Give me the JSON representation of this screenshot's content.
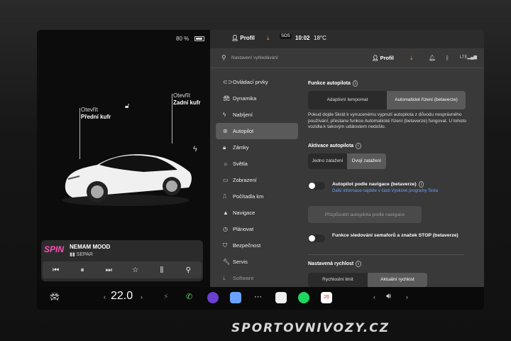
{
  "status_bar": {
    "battery": "80 %",
    "profile": "Profil",
    "time": "10:02",
    "temperature": "18°C",
    "sos": "SOS"
  },
  "car": {
    "front_trunk": {
      "action": "Otevřít",
      "name": "Přední kufr"
    },
    "rear_trunk": {
      "action": "Otevřít",
      "name": "Zadní kufr"
    }
  },
  "media": {
    "album": "SPIN",
    "title": "NEMAM MOOD",
    "artist": "SEPAR"
  },
  "search": {
    "placeholder": "Nastavení vyhledávání",
    "profile": "Profil"
  },
  "nav": [
    {
      "label": "Ovládací prvky",
      "icon": "toggle-icon"
    },
    {
      "label": "Dynamika",
      "icon": "car-icon"
    },
    {
      "label": "Nabíjení",
      "icon": "bolt-icon"
    },
    {
      "label": "Autopilot",
      "icon": "steering-icon"
    },
    {
      "label": "Zámky",
      "icon": "lock-icon"
    },
    {
      "label": "Světla",
      "icon": "light-icon"
    },
    {
      "label": "Zobrazení",
      "icon": "display-icon"
    },
    {
      "label": "Počítadla km",
      "icon": "trip-icon"
    },
    {
      "label": "Navigace",
      "icon": "navigation-icon"
    },
    {
      "label": "Plánovat",
      "icon": "clock-icon"
    },
    {
      "label": "Bezpečnost",
      "icon": "shield-icon"
    },
    {
      "label": "Servis",
      "icon": "wrench-icon"
    },
    {
      "label": "Software",
      "icon": "download-icon"
    }
  ],
  "autopilot": {
    "features_title": "Funkce autopilota",
    "feature_options": [
      "Adaptivní tempomat",
      "Automatické řízení (betaverze)"
    ],
    "warning": "Pokud dojde 5krát k vynucenému vypnutí autopilota z důvodu nesprávného používání, přestane funkce Automatické řízení (betaverze) fungovat. U tohoto vozidla k takovým událostem nedošlo.",
    "activation_title": "Aktivace autopilota",
    "activation_options": [
      "Jedno zatažení",
      "Dvojí zatažení"
    ],
    "nav_autopilot_title": "Autopilot podle navigace (betaverze)",
    "nav_autopilot_link": "Další informace najdete v části Výukové programy Tesla",
    "customize_button": "Přizpůsobit autopilota podle navigace",
    "traffic_light_title": "Funkce sledování semaforů a značek STOP (betaverze)",
    "speed_title": "Nastavená rychlost",
    "speed_options": [
      "Rychlostní limit",
      "Aktuální rychlost"
    ]
  },
  "dock": {
    "temperature": "22.0"
  },
  "watermark": "SPORTOVNIVOZY.CZ"
}
